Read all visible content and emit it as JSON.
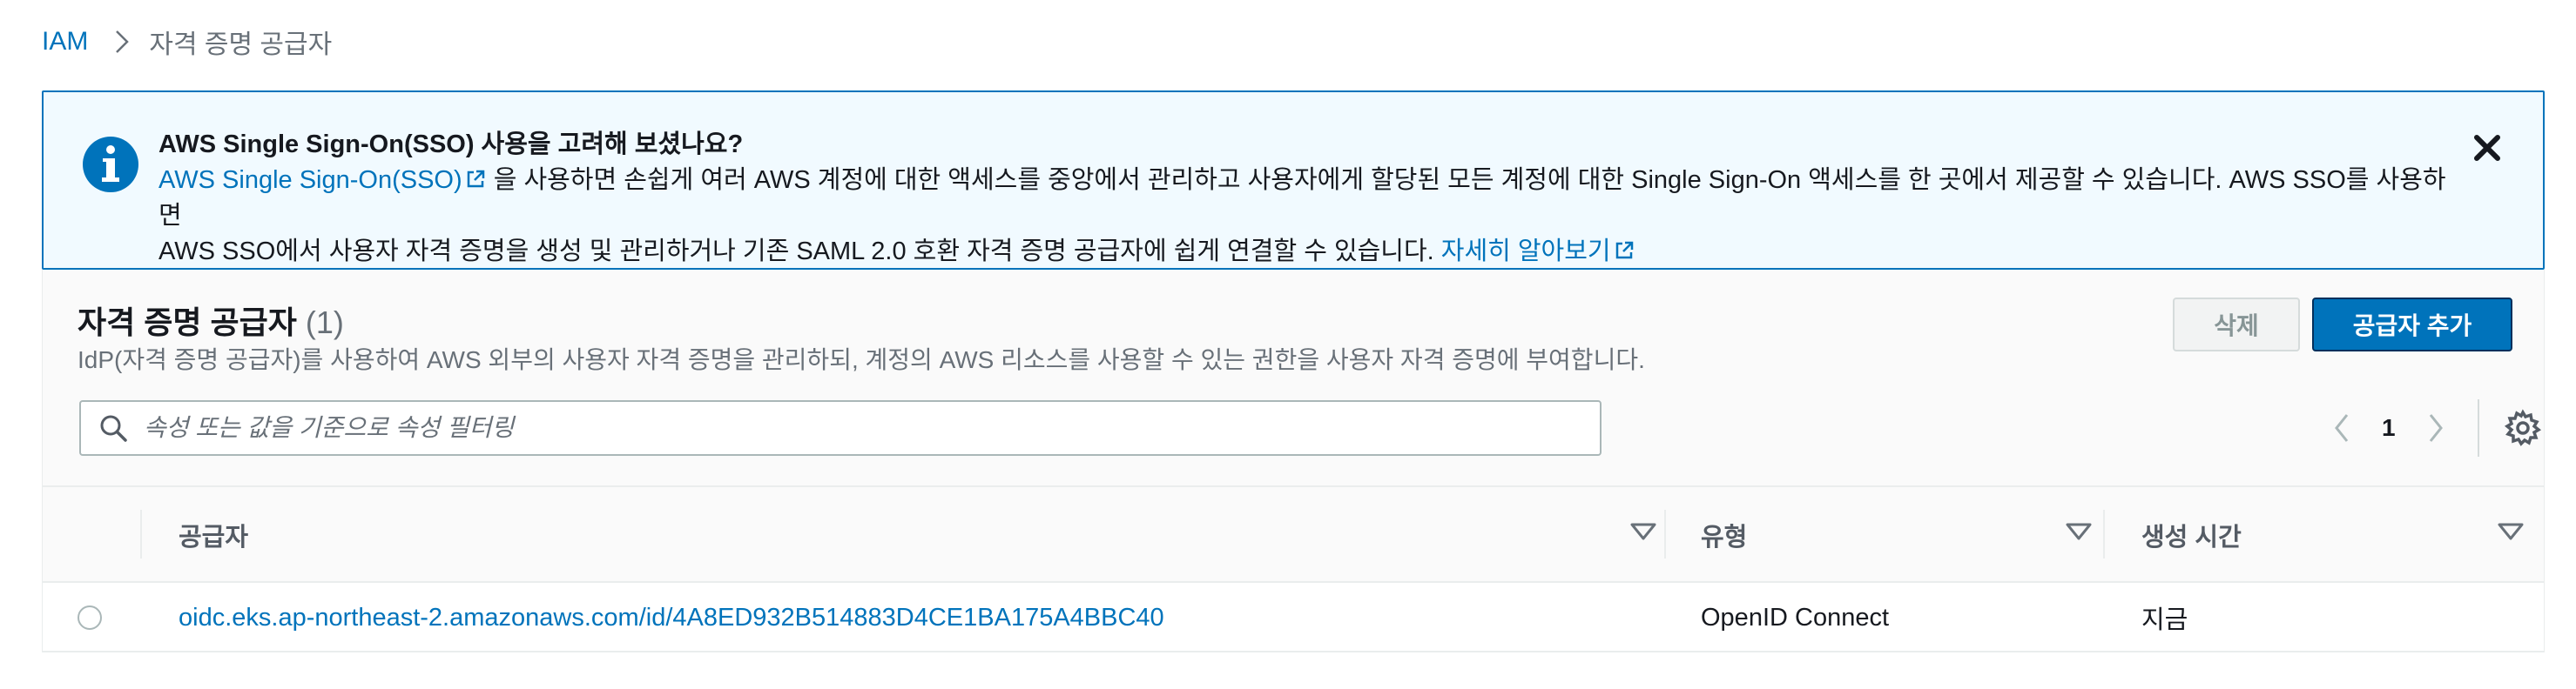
{
  "breadcrumb": {
    "root": "IAM",
    "current": "자격 증명 공급자"
  },
  "banner": {
    "title": "AWS Single Sign-On(SSO) 사용을 고려해 보셨나요?",
    "link1": "AWS Single Sign-On(SSO)",
    "body1": " 을 사용하면 손쉽게 여러 AWS 계정에 대한 액세스를 중앙에서 관리하고 사용자에게 할당된 모든 계정에 대한 Single Sign-On 액세스를 한 곳에서 제공할 수 있습니다. AWS SSO를 사용하면",
    "body2": "AWS SSO에서 사용자 자격 증명을 생성 및 관리하거나 기존 SAML 2.0 호환 자격 증명 공급자에 쉽게 연결할 수 있습니다. ",
    "link2": "자세히 알아보기"
  },
  "section": {
    "title": "자격 증명 공급자",
    "count": "(1)",
    "description": "IdP(자격 증명 공급자)를 사용하여 AWS 외부의 사용자 자격 증명을 관리하되, 계정의 AWS 리소스를 사용할 수 있는 권한을 사용자 자격 증명에 부여합니다."
  },
  "buttons": {
    "delete": "삭제",
    "add": "공급자 추가"
  },
  "search": {
    "placeholder": "속성 또는 값을 기준으로 속성 필터링",
    "value": ""
  },
  "pagination": {
    "page": "1"
  },
  "table": {
    "columns": [
      "공급자",
      "유형",
      "생성 시간"
    ],
    "rows": [
      {
        "provider": "oidc.eks.ap-northeast-2.amazonaws.com/id/4A8ED932B514883D4CE1BA175A4BBC40",
        "type": "OpenID Connect",
        "created": "지금"
      }
    ]
  },
  "colors": {
    "accent": "#0073bb",
    "banner_bg": "#f1faff",
    "primary_button": "#0073bb"
  }
}
